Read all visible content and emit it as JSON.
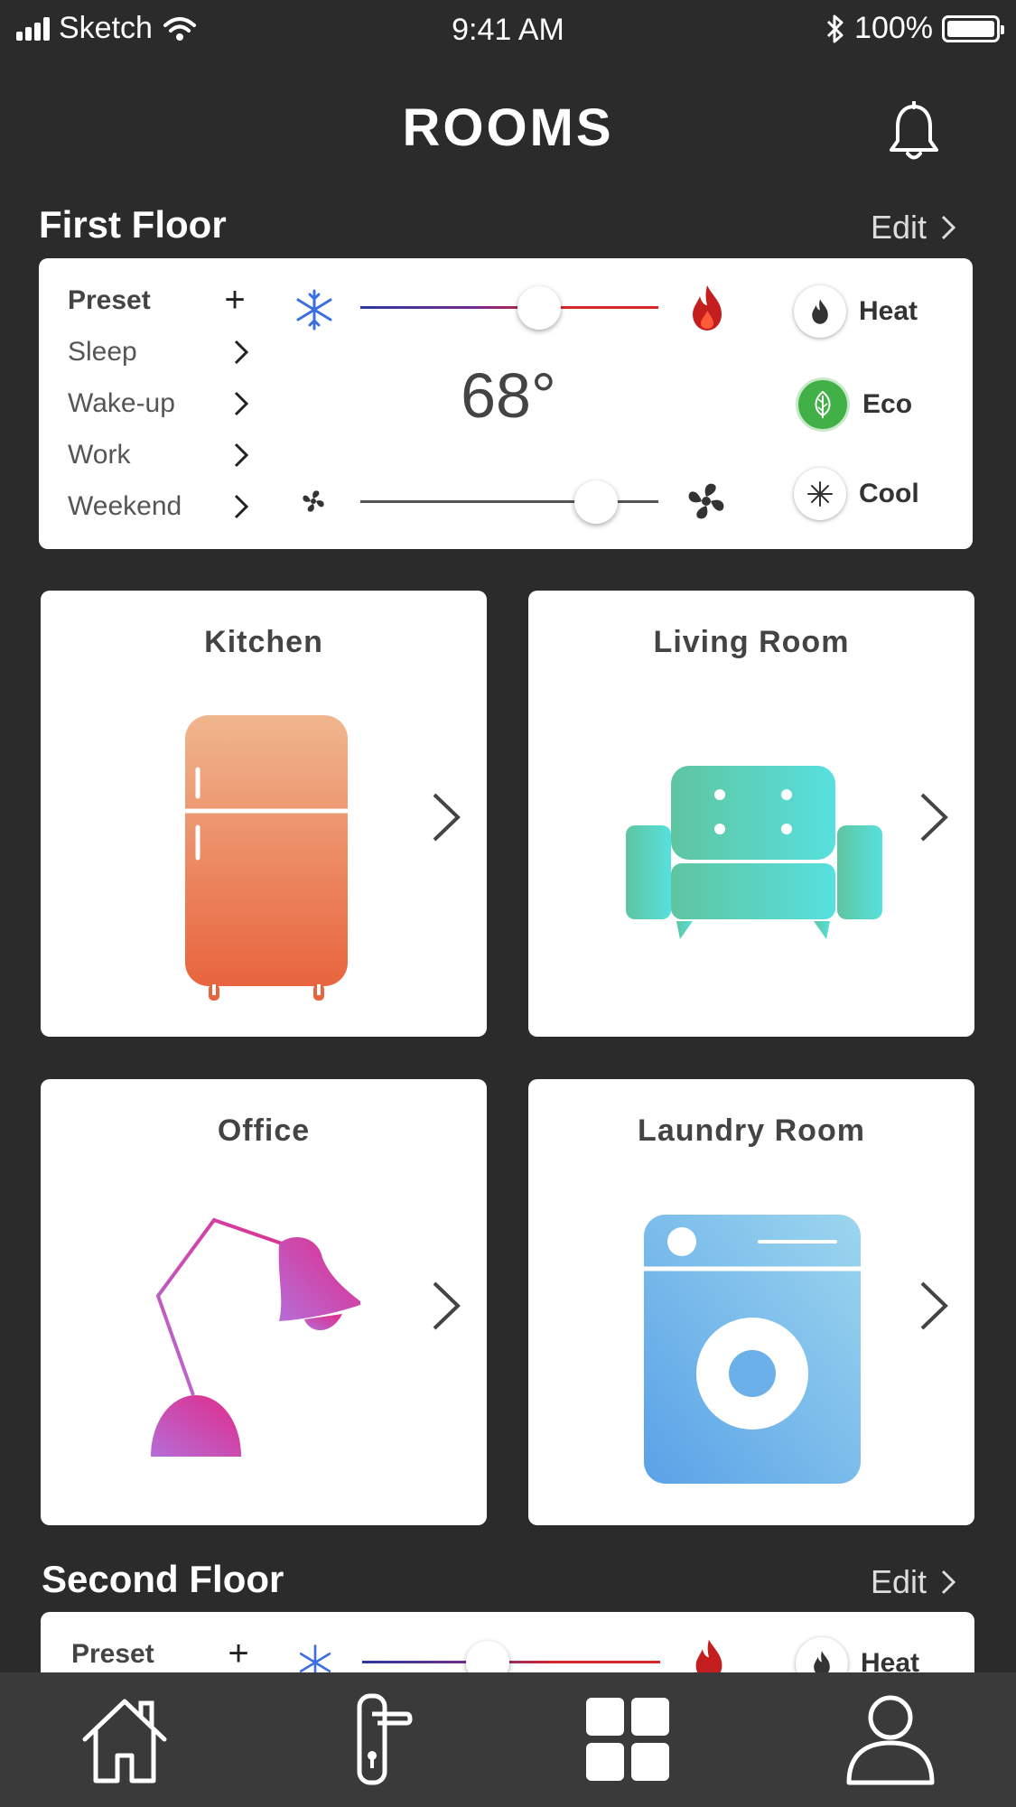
{
  "status": {
    "carrier": "Sketch",
    "time": "9:41 AM",
    "battery": "100%"
  },
  "header": {
    "title": "ROOMS"
  },
  "floors": [
    {
      "name": "First Floor",
      "edit_label": "Edit",
      "preset": {
        "header": "Preset",
        "items": [
          "Sleep",
          "Wake-up",
          "Work",
          "Weekend"
        ],
        "temperature": "68°",
        "temp_slider_level": 0.6,
        "fan_slider_level": 0.79,
        "modes": [
          "Heat",
          "Eco",
          "Cool"
        ],
        "active_mode": "Eco"
      }
    },
    {
      "name": "Second Floor",
      "edit_label": "Edit",
      "preset": {
        "header": "Preset",
        "temp_slider_level": 0.42,
        "modes": [
          "Heat"
        ]
      }
    }
  ],
  "rooms": [
    {
      "name": "Kitchen",
      "icon": "fridge-icon",
      "colors": [
        "#f0b68e",
        "#e8643e"
      ]
    },
    {
      "name": "Living Room",
      "icon": "sofa-icon",
      "colors": [
        "#5fc5a0",
        "#57e0de"
      ]
    },
    {
      "name": "Office",
      "icon": "desk-lamp-icon",
      "colors": [
        "#b56dd6",
        "#e22a8a"
      ]
    },
    {
      "name": "Laundry Room",
      "icon": "washing-machine-icon",
      "colors": [
        "#9cd6ee",
        "#5aa2e8"
      ]
    }
  ],
  "tabbar": {
    "tabs": [
      "home-icon",
      "door-handle-icon",
      "grid-icon",
      "profile-icon"
    ],
    "active": "grid-icon"
  },
  "colors": {
    "background": "#2b2b2b",
    "card": "#ffffff",
    "cold": "#3b6fe0",
    "hot": "#d62828",
    "eco": "#41b046"
  }
}
